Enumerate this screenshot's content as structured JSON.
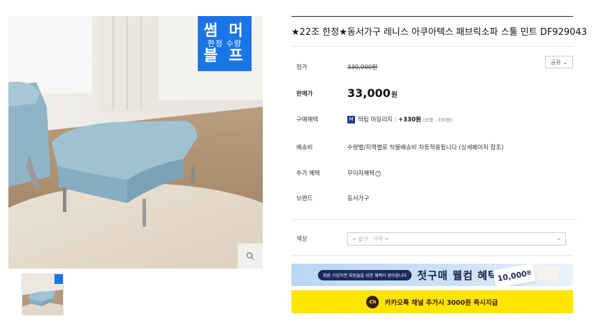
{
  "product": {
    "title": "★22조 한정★동서가구 레니스 아쿠아텍스 패브릭소파 스툴 민트 DF929043",
    "share_label": "공유 ⌄"
  },
  "badge": {
    "line1": "썸 머",
    "line2": "한정 수량",
    "line3": "블 프"
  },
  "thumb_badge": "썸머 블프",
  "rows": {
    "list_price_label": "정가",
    "list_price": "330,000원",
    "sale_price_label": "판매가",
    "sale_price": "33,000",
    "sale_price_unit": "원",
    "benefit_label": "구매혜택",
    "benefit_icon": "M",
    "benefit_text": "적립 마일리지 : ",
    "benefit_amount": "+330원",
    "benefit_sub": "(상품 : 330원)",
    "shipping_label": "배송비",
    "shipping_text": "수량별/지역별로 착불배송비 차등적용됩니다 (상세페이지 참조)",
    "extra_label": "추가 혜택",
    "extra_text": "무이자혜택",
    "brand_label": "브랜드",
    "brand_text": "동서가구"
  },
  "option": {
    "label": "색상",
    "placeholder": "= 옵션 : 가격 ="
  },
  "banner_welcome": {
    "pill": "회원 가입하면 회원들을 위한 혜택이 쏟아집니다",
    "headline": "첫구매 웰컴 혜택",
    "coupon_amount": "10,000",
    "coupon_unit": "원"
  },
  "banner_kakao": {
    "icon_text": "Ch",
    "text": "카카오톡 채널 추가시 3000원 즉시지급"
  },
  "colors": {
    "badge_blue": "#1a75e6",
    "kakao_yellow": "#fde500",
    "kakao_brown": "#3a1d1d",
    "welcome_navy": "#14224f"
  }
}
